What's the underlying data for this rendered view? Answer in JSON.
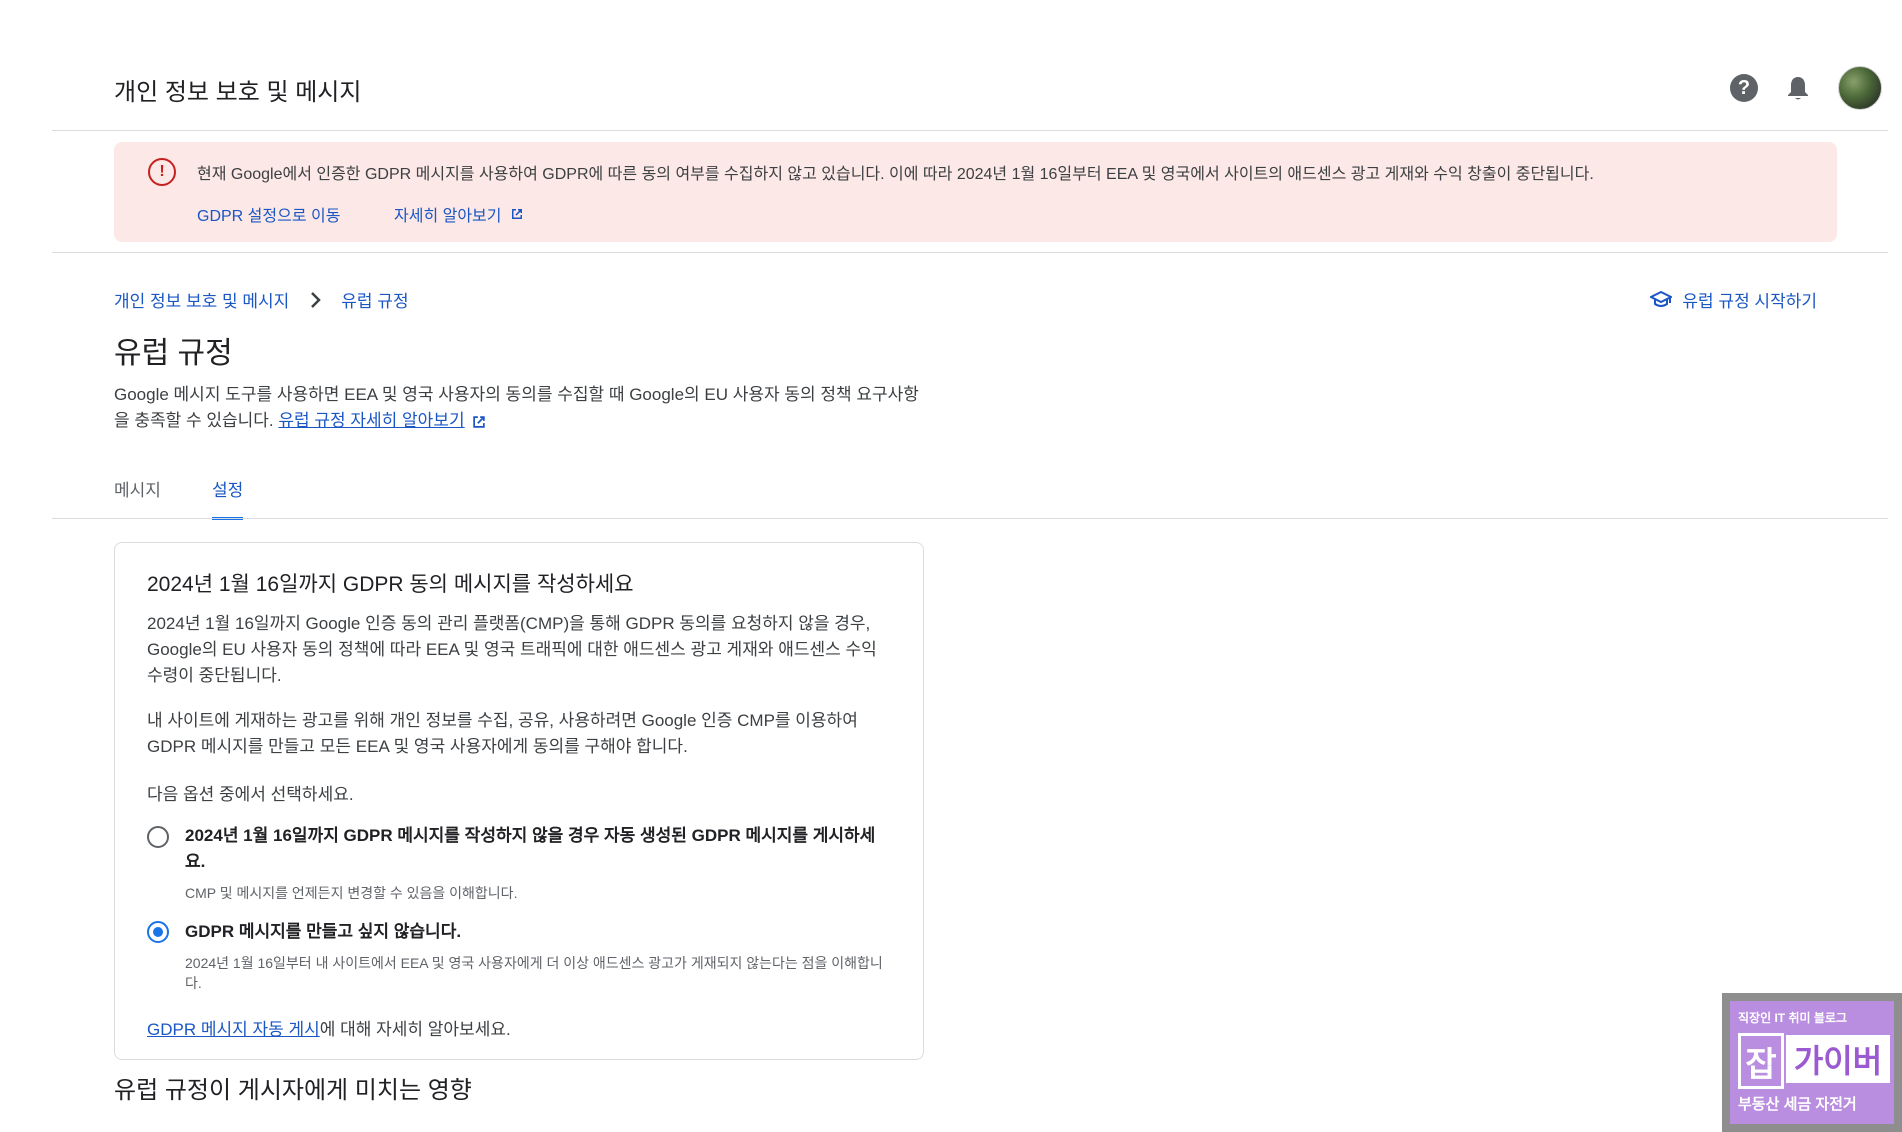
{
  "header": {
    "title": "개인 정보 보호 및 메시지",
    "help_icon": "?",
    "colors": {
      "icon": "#5f6368"
    }
  },
  "alert": {
    "icon": "!",
    "text": "현재 Google에서 인증한 GDPR 메시지를 사용하여 GDPR에 따른 동의 여부를 수집하지 않고 있습니다. 이에 따라 2024년 1월 16일부터 EEA 및 영국에서 사이트의 애드센스 광고 게재와 수익 창출이 중단됩니다.",
    "link_settings": "GDPR 설정으로 이동",
    "link_learn": "자세히 알아보기",
    "background": "#fce8e6"
  },
  "breadcrumb": {
    "parent": "개인 정보 보호 및 메시지",
    "current": "유럽 규정"
  },
  "getting_started": "유럽 규정 시작하기",
  "page": {
    "title": "유럽 규정",
    "desc": "Google 메시지 도구를 사용하면 EEA 및 영국 사용자의 동의를 수집할 때 Google의 EU 사용자 동의 정책 요구사항을 충족할 수 있습니다. ",
    "desc_link": "유럽 규정 자세히 알아보기"
  },
  "tabs": [
    {
      "label": "메시지"
    },
    {
      "label": "설정"
    }
  ],
  "card": {
    "title": "2024년 1월 16일까지 GDPR 동의 메시지를 작성하세요",
    "p1": "2024년 1월 16일까지 Google 인증 동의 관리 플랫폼(CMP)을 통해 GDPR 동의를 요청하지 않을 경우, Google의 EU 사용자 동의 정책에 따라 EEA 및 영국 트래픽에 대한 애드센스 광고 게재와 애드센스 수익 수령이 중단됩니다.",
    "p2": "내 사이트에 게재하는 광고를 위해 개인 정보를 수집, 공유, 사용하려면 Google 인증 CMP를 이용하여 GDPR 메시지를 만들고 모든 EEA 및 영국 사용자에게 동의를 구해야 합니다.",
    "p3": "다음 옵션 중에서 선택하세요.",
    "option1": {
      "label": "2024년 1월 16일까지 GDPR 메시지를 작성하지 않을 경우 자동 생성된 GDPR 메시지를 게시하세요.",
      "sub": "CMP 및 메시지를 언제든지 변경할 수 있음을 이해합니다.",
      "selected": false
    },
    "option2": {
      "label": "GDPR 메시지를 만들고 싶지 않습니다.",
      "sub": "2024년 1월 16일부터 내 사이트에서 EEA 및 영국 사용자에게 더 이상 애드센스 광고가 게재되지 않는다는 점을 이해합니다.",
      "selected": true
    },
    "foot_link": "GDPR 메시지 자동 게시",
    "foot_text": "에 대해 자세히 알아보세요."
  },
  "section_title": "유럽 규정이 게시자에게 미치는 영향",
  "watermark": {
    "top": "직장인 IT 취미 블로그",
    "big_char": "잡",
    "big_text": "가이버",
    "bottom": "부동산 세금 자전거"
  },
  "accent": "#1a73e8",
  "link_color": "#1a56c4"
}
